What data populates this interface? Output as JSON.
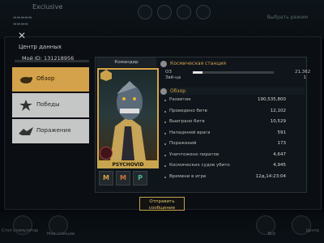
{
  "background": {
    "top_title": "Exclusive",
    "top_right_label": "Выбрать режим",
    "bottom_left_label": "Стоп стимулятор",
    "bottom_left_label2": "Мои станции",
    "bottom_right_label": "Всё",
    "bottom_right_label2": "Центр"
  },
  "dialog": {
    "title": "Центр данных",
    "my_id": "Мой ID: 131218956",
    "close_icon": "close-icon"
  },
  "sidebar": {
    "items": [
      {
        "label": "Обзор",
        "icon": "rat-icon",
        "active": true
      },
      {
        "label": "Победы",
        "icon": "blast-icon",
        "active": false
      },
      {
        "label": "Поражения",
        "icon": "wreck-icon",
        "active": false
      }
    ]
  },
  "commander": {
    "header": "Командир",
    "name": "PSYCHOVID",
    "medals": [
      "M",
      "M",
      "P"
    ]
  },
  "station": {
    "title": "Космическая станция",
    "level_label_a": "ОЗ",
    "level_label_b": "Звё-ца",
    "level_value": "21,362",
    "level_value_b": "1",
    "progress": 0.12
  },
  "overview": {
    "title": "Обзор",
    "stats": [
      {
        "label": "Развитие",
        "value": "190,535,800"
      },
      {
        "label": "Проведено битв",
        "value": "12,102"
      },
      {
        "label": "Выиграно битв",
        "value": "10,529"
      },
      {
        "label": "Нападений врага",
        "value": "591"
      },
      {
        "label": "Поражений",
        "value": "173"
      },
      {
        "label": "Уничтожено пиратов",
        "value": "4,647"
      },
      {
        "label": "Космических судов убито",
        "value": "4,945"
      },
      {
        "label": "Времени в игре",
        "value": "12д,14:23:04"
      }
    ]
  },
  "send_button": {
    "line1": "Отправить",
    "line2": "сообщение"
  }
}
